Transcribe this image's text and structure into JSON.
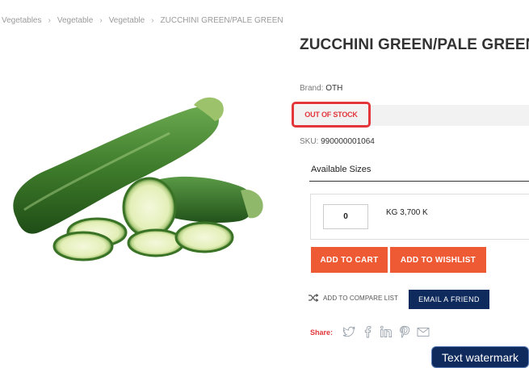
{
  "breadcrumb": {
    "items": [
      "Vegetables",
      "Vegetable",
      "Vegetable",
      "ZUCCHINI GREEN/PALE GREEN"
    ],
    "separator": "›"
  },
  "product": {
    "title": "ZUCCHINI GREEN/PALE GREEN",
    "brand_label": "Brand:",
    "brand_value": "OTH",
    "stock_status": "OUT OF STOCK",
    "sku_label": "SKU:",
    "sku_value": "990000001064",
    "image_icon": "zucchini-image"
  },
  "sizes": {
    "label": "Available Sizes",
    "quantity": "0",
    "size_text": "KG 3,700 K"
  },
  "actions": {
    "add_to_cart": "ADD TO CART",
    "add_to_wishlist": "ADD TO WISHLIST",
    "compare": "ADD TO COMPARE LIST",
    "compare_icon": "shuffle-icon",
    "email_friend": "EMAIL A FRIEND"
  },
  "share": {
    "label": "Share:",
    "icons": [
      "twitter-icon",
      "facebook-icon",
      "linkedin-icon",
      "pinterest-icon",
      "email-icon"
    ]
  },
  "watermark": "Text watermark",
  "colors": {
    "accent_orange": "#ee5a34",
    "stock_red": "#e2363b",
    "navy": "#0f2a5c"
  }
}
